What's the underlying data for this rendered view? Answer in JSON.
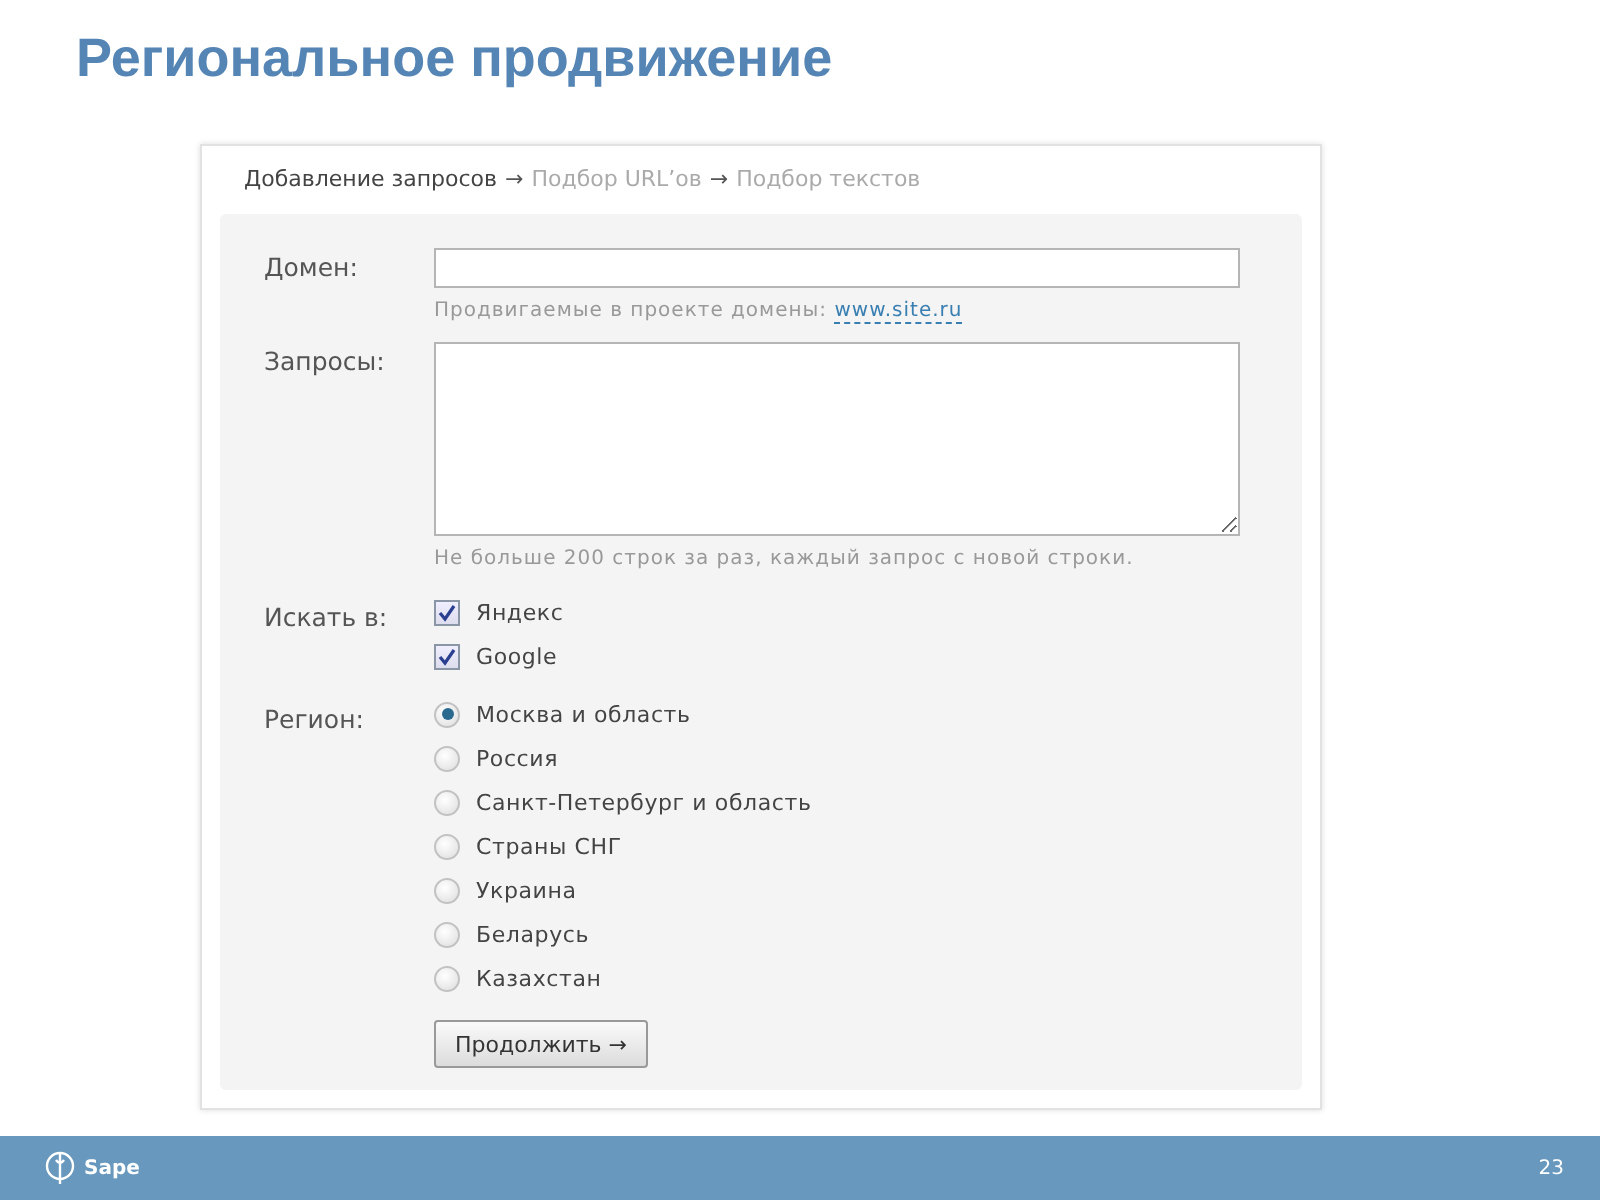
{
  "title": "Региональное продвижение",
  "breadcrumb": [
    {
      "label": "Добавление запросов",
      "selected": true,
      "arrow_after": "→"
    },
    {
      "label": "Подбор URL’ов",
      "selected": false,
      "arrow_after": "→"
    },
    {
      "label": "Подбор текстов",
      "selected": false
    }
  ],
  "form": {
    "domain": {
      "label": "Домен:",
      "hint": "Продвигаемые в проекте домены:",
      "hint_link": "www.site.ru"
    },
    "queries": {
      "label": "Запросы:",
      "hint": "Не больше 200 строк за раз, каждый запрос с новой строки."
    },
    "search_in": {
      "label": "Искать в:",
      "options": [
        {
          "label": "Яндекс",
          "checked": true
        },
        {
          "label": "Google",
          "checked": true
        }
      ]
    },
    "region": {
      "label": "Регион:",
      "options": [
        {
          "label": "Москва и область",
          "selected": true
        },
        {
          "label": "Россия",
          "selected": false
        },
        {
          "label": "Санкт-Петербург и область",
          "selected": false
        },
        {
          "label": "Страны СНГ",
          "selected": false
        },
        {
          "label": "Украина",
          "selected": false
        },
        {
          "label": "Беларусь",
          "selected": false
        },
        {
          "label": "Казахстан",
          "selected": false
        }
      ]
    },
    "submit": "Продолжить →"
  },
  "footer": {
    "logo": "Sape",
    "page_number": "23"
  }
}
